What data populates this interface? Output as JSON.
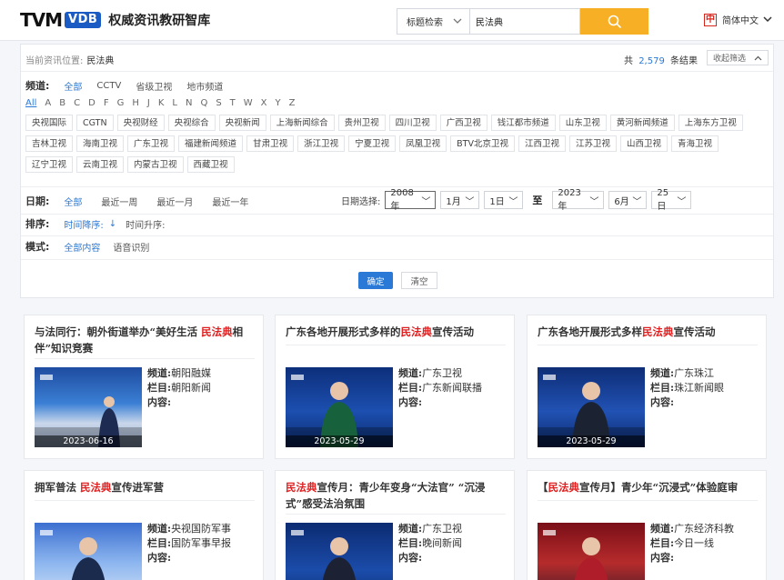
{
  "header": {
    "logo_tvm": "TVM",
    "logo_vdb": "VDB",
    "site_name": "权威资讯教研智库",
    "search_type": "标题检索",
    "search_value": "民法典",
    "lang_icon": "中",
    "lang_label": "简体中文"
  },
  "location": {
    "label": "当前资讯位置:",
    "value": "民法典"
  },
  "results": {
    "prefix": "共",
    "count": "2,579",
    "suffix": "条结果",
    "collapse_label": "收起筛选"
  },
  "channel_filter": {
    "label": "频道:",
    "options": [
      "全部",
      "CCTV",
      "省级卫视",
      "地市频道"
    ],
    "letters": [
      "All",
      "A",
      "B",
      "C",
      "D",
      "F",
      "G",
      "H",
      "J",
      "K",
      "L",
      "N",
      "Q",
      "S",
      "T",
      "W",
      "X",
      "Y",
      "Z"
    ],
    "channels": [
      "央视国际",
      "CGTN",
      "央视财经",
      "央视综合",
      "央视新闻",
      "上海新闻综合",
      "贵州卫视",
      "四川卫视",
      "广西卫视",
      "钱江都市频道",
      "山东卫视",
      "黄河新闻频道",
      "上海东方卫视",
      "吉林卫视",
      "海南卫视",
      "广东卫视",
      "福建新闻频道",
      "甘肃卫视",
      "浙江卫视",
      "宁夏卫视",
      "凤凰卫视",
      "BTV北京卫视",
      "江西卫视",
      "江苏卫视",
      "山西卫视",
      "青海卫视",
      "辽宁卫视",
      "云南卫视",
      "内蒙古卫视",
      "西藏卫视"
    ]
  },
  "date_filter": {
    "label": "日期:",
    "options": [
      "全部",
      "最近一周",
      "最近一月",
      "最近一年"
    ],
    "picker_label": "日期选择:",
    "from": {
      "year": "2008年",
      "month": "1月",
      "day": "1日"
    },
    "to_label": "至",
    "to": {
      "year": "2023年",
      "month": "6月",
      "day": "25日"
    }
  },
  "sort_filter": {
    "label": "排序:",
    "desc": "时间降序:",
    "desc_arrow": "↓",
    "asc": "时间升序:"
  },
  "mode_filter": {
    "label": "模式:",
    "options": [
      "全部内容",
      "语音识别"
    ]
  },
  "buttons": {
    "confirm": "确定",
    "clear": "清空"
  },
  "meta_labels": {
    "channel": "频道:",
    "program": "栏目:",
    "content": "内容:"
  },
  "cards": [
    {
      "title_pre": "与法同行：朝外街道举办“美好生活 ",
      "title_hl": "民法典",
      "title_post": "相伴”知识竞赛",
      "channel": "朝阳融媒",
      "program": "朝阳新闻",
      "date": "2023-06-16"
    },
    {
      "title_pre": "广东各地开展形式多样的",
      "title_hl": "民法典",
      "title_post": "宣传活动",
      "channel": "广东卫视",
      "program": "广东新闻联播",
      "date": "2023-05-29"
    },
    {
      "title_pre": "广东各地开展形式多样",
      "title_hl": "民法典",
      "title_post": "宣传活动",
      "channel": "广东珠江",
      "program": "珠江新闻眼",
      "date": "2023-05-29"
    },
    {
      "title_pre": "拥军普法 ",
      "title_hl": "民法典",
      "title_post": "宣传进军营",
      "channel": "央视国防军事",
      "program": "国防军事早报",
      "date": ""
    },
    {
      "title_pre": "",
      "title_hl": "民法典",
      "title_post": "宣传月：青少年变身“大法官” “沉浸式”感受法治氛围",
      "channel": "广东卫视",
      "program": "晚间新闻",
      "date": ""
    },
    {
      "title_pre": "【",
      "title_hl": "民法典",
      "title_post": "宣传月】青少年“沉浸式”体验庭审",
      "channel": "广东经济科教",
      "program": "今日一线",
      "date": ""
    }
  ],
  "colors": {
    "accent": "#2a79d6",
    "search_button": "#f7b026",
    "highlight": "#e02020",
    "brand_blue": "#1a5bc4"
  }
}
